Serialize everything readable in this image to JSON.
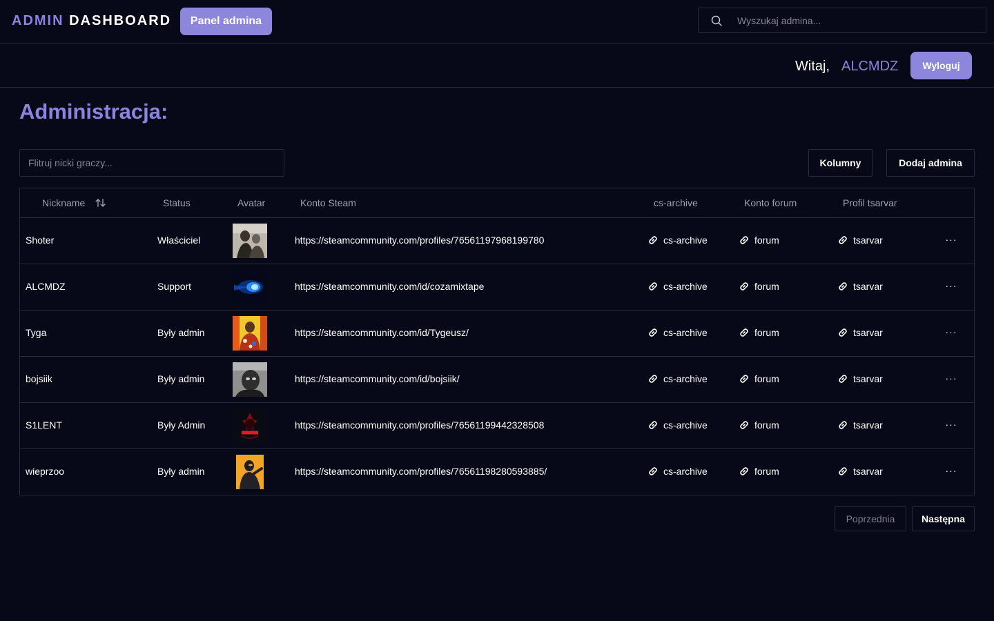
{
  "header": {
    "brand_part1": "ADMIN",
    "brand_part2": "DASHBOARD",
    "panel_button": "Panel admina",
    "search_placeholder": "Wyszukaj admina..."
  },
  "userbar": {
    "welcome": "Witaj,",
    "username": "ALCMDZ",
    "logout_button": "Wyloguj"
  },
  "main": {
    "title": "Administracja:",
    "filter_placeholder": "Flitruj nicki graczy...",
    "columns_button": "Kolumny",
    "add_button": "Dodaj admina"
  },
  "table": {
    "headers": {
      "nickname": "Nickname",
      "status": "Status",
      "avatar": "Avatar",
      "steam": "Konto Steam",
      "archive": "cs-archive",
      "forum": "Konto forum",
      "tsarvar": "Profil tsarvar"
    },
    "rows": [
      {
        "nickname": "Shoter",
        "status": "Właściciel",
        "avatar": "avatar-bw-portrait",
        "steam": "https://steamcommunity.com/profiles/76561197968199780",
        "archive": "cs-archive",
        "forum": "forum",
        "tsarvar": "tsarvar"
      },
      {
        "nickname": "ALCMDZ",
        "status": "Support",
        "avatar": "avatar-blue-orb",
        "steam": "https://steamcommunity.com/id/cozamixtape",
        "archive": "cs-archive",
        "forum": "forum",
        "tsarvar": "tsarvar"
      },
      {
        "nickname": "Tyga",
        "status": "Były admin",
        "avatar": "avatar-colorful-person",
        "steam": "https://steamcommunity.com/id/Tygeusz/",
        "archive": "cs-archive",
        "forum": "forum",
        "tsarvar": "tsarvar"
      },
      {
        "nickname": "bojsiik",
        "status": "Były admin",
        "avatar": "avatar-bw-face",
        "steam": "https://steamcommunity.com/id/bojsiik/",
        "archive": "cs-archive",
        "forum": "forum",
        "tsarvar": "tsarvar"
      },
      {
        "nickname": "S1LENT",
        "status": "Były Admin",
        "avatar": "avatar-silent-logo",
        "steam": "https://steamcommunity.com/profiles/76561199442328508",
        "archive": "cs-archive",
        "forum": "forum",
        "tsarvar": "tsarvar"
      },
      {
        "nickname": "wieprzoo",
        "status": "Były admin",
        "avatar": "avatar-orange-figure",
        "steam": "https://steamcommunity.com/profiles/76561198280593885/",
        "archive": "cs-archive",
        "forum": "forum",
        "tsarvar": "tsarvar"
      }
    ]
  },
  "pagination": {
    "prev": "Poprzednia",
    "next": "Następna"
  },
  "colors": {
    "accent": "#8c86dc",
    "background": "#070818",
    "border": "#2a2c3e"
  }
}
